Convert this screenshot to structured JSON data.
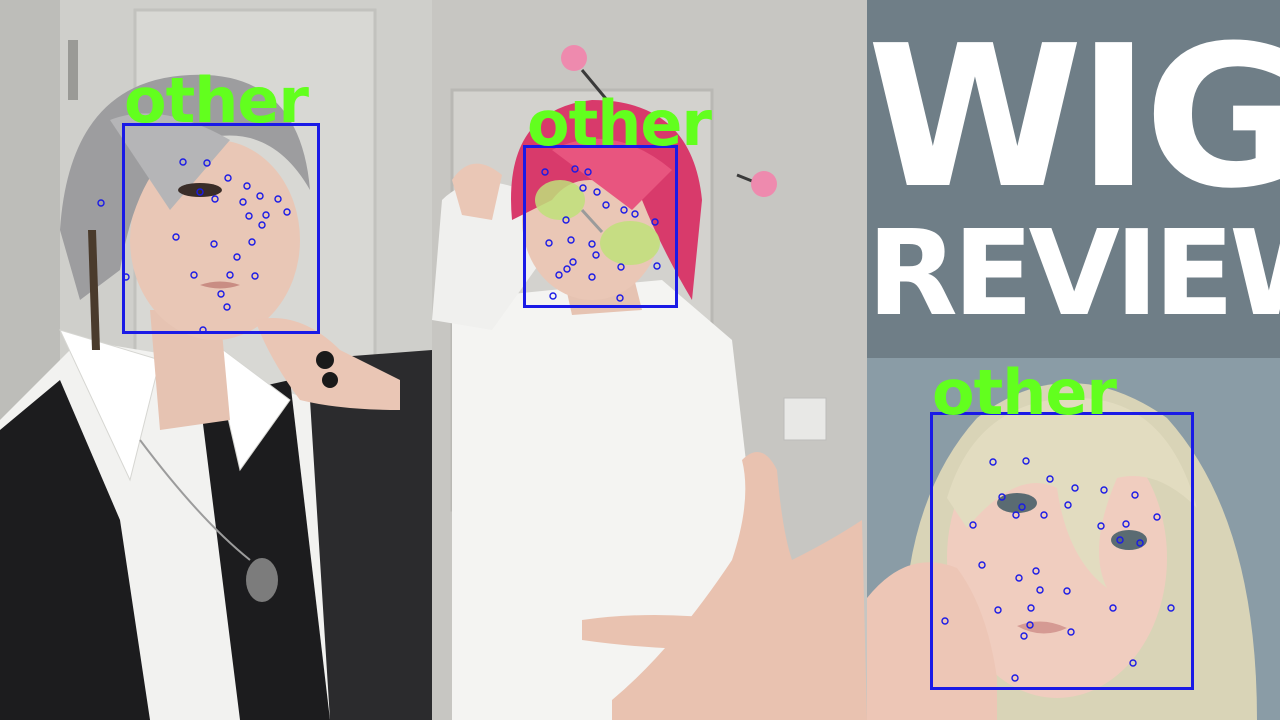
{
  "thumbnail": {
    "title_line_1": "WIG",
    "title_line_2": "REVIEW"
  },
  "detections": [
    {
      "label": "other"
    },
    {
      "label": "other"
    },
    {
      "label": "other"
    }
  ],
  "colors": {
    "box": "#1a1ae6",
    "label": "#62ff1e",
    "title": "#ffffff",
    "title_background": "#6f7e87"
  }
}
